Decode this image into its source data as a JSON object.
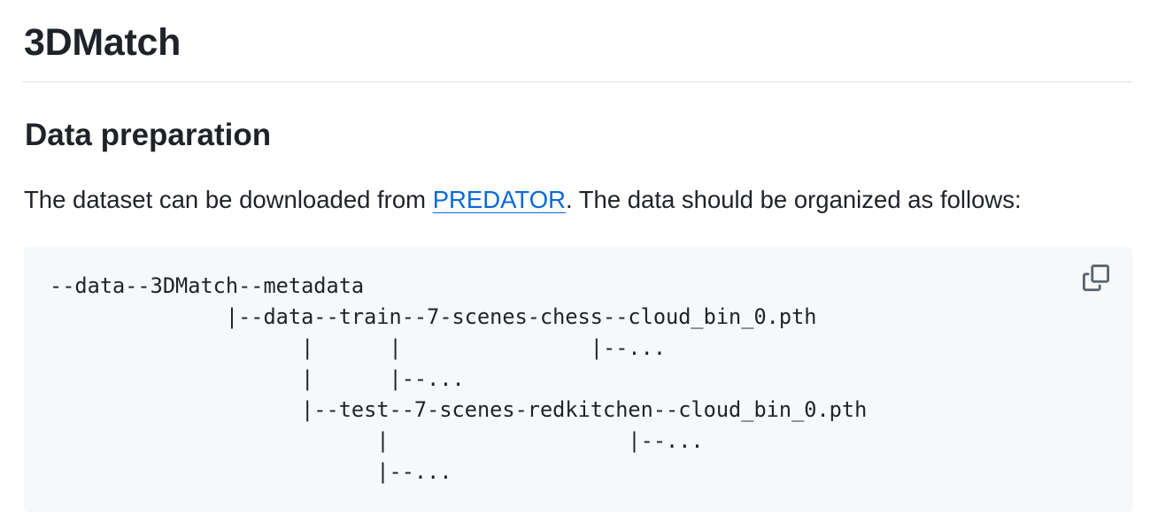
{
  "heading": "3DMatch",
  "section": {
    "title": "Data preparation",
    "intro_before": "The dataset can be downloaded from ",
    "link_text": "PREDATOR",
    "intro_after": ". The data should be organized as follows:"
  },
  "code_block": {
    "text": "--data--3DMatch--metadata\n              |--data--train--7-scenes-chess--cloud_bin_0.pth\n                    |      |               |--...\n                    |      |--...\n                    |--test--7-scenes-redkitchen--cloud_bin_0.pth\n                          |                   |--...\n                          |--...",
    "copy_icon": "copy-icon"
  }
}
